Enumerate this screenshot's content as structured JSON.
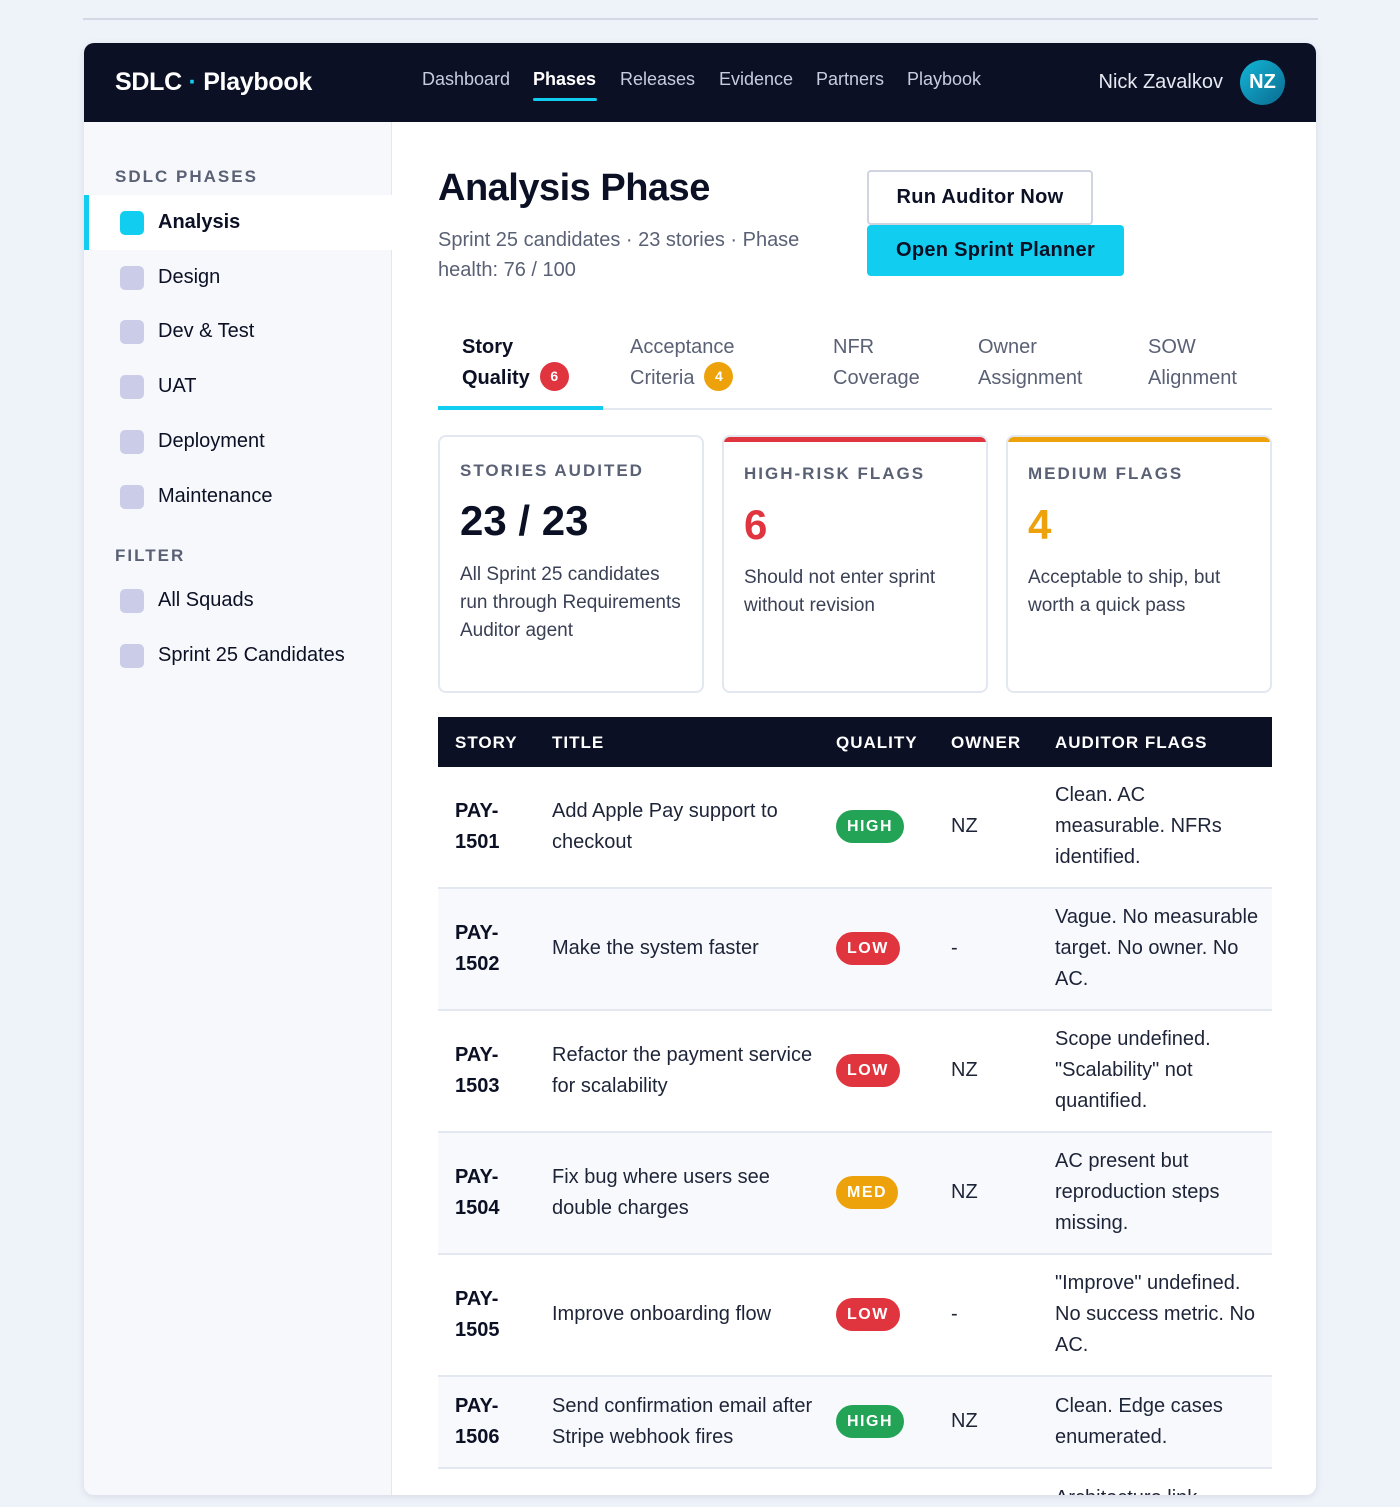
{
  "app": {
    "brand_left": "SDLC",
    "brand_dot": " · ",
    "brand_right": "Playbook"
  },
  "nav": {
    "items": [
      {
        "label": "Dashboard"
      },
      {
        "label": "Phases"
      },
      {
        "label": "Releases"
      },
      {
        "label": "Evidence"
      },
      {
        "label": "Partners"
      },
      {
        "label": "Playbook"
      }
    ],
    "active": "Phases"
  },
  "user": {
    "name": "Nick Zavalkov",
    "initials": "NZ"
  },
  "sidebar": {
    "phases_heading": "SDLC PHASES",
    "phases": [
      {
        "label": "Analysis"
      },
      {
        "label": "Design"
      },
      {
        "label": "Dev & Test"
      },
      {
        "label": "UAT"
      },
      {
        "label": "Deployment"
      },
      {
        "label": "Maintenance"
      }
    ],
    "filter_heading": "FILTER",
    "filters": [
      {
        "label": "All Squads"
      },
      {
        "label": "Sprint 25 Candidates"
      }
    ]
  },
  "page": {
    "title": "Analysis Phase",
    "subtitle": "Sprint 25 candidates · 23 stories · Phase health: 76 / 100",
    "run_auditor_label": "Run Auditor Now",
    "open_planner_label": "Open Sprint Planner"
  },
  "tabs": [
    {
      "line1": "Story",
      "line2": "Quality",
      "count": "6"
    },
    {
      "line1": "Acceptance",
      "line2": "Criteria",
      "count": "4"
    },
    {
      "line1": "NFR",
      "line2": "Coverage"
    },
    {
      "line1": "Owner",
      "line2": "Assignment"
    },
    {
      "line1": "SOW",
      "line2": "Alignment"
    }
  ],
  "cards": [
    {
      "label": "STORIES AUDITED",
      "value": "23 / 23",
      "desc": "All Sprint 25 candidates run through Requirements Auditor agent"
    },
    {
      "label": "HIGH-RISK FLAGS",
      "value": "6",
      "desc": "Should not enter sprint without revision",
      "accent": "#e0353f"
    },
    {
      "label": "MEDIUM FLAGS",
      "value": "4",
      "desc": "Acceptable to ship, but worth a quick pass",
      "accent": "#eda20b"
    }
  ],
  "table": {
    "headers": [
      "STORY",
      "TITLE",
      "QUALITY",
      "OWNER",
      "AUDITOR FLAGS"
    ],
    "rows": [
      {
        "story_a": "PAY-",
        "story_b": "1501",
        "title": "Add Apple Pay support to checkout",
        "quality": "HIGH",
        "owner": "NZ",
        "flags": "Clean. AC measurable. NFRs identified."
      },
      {
        "story_a": "PAY-",
        "story_b": "1502",
        "title": "Make the system faster",
        "quality": "LOW",
        "owner": "-",
        "flags": "Vague. No measurable target. No owner. No AC."
      },
      {
        "story_a": "PAY-",
        "story_b": "1503",
        "title": "Refactor the payment service for scalability",
        "quality": "LOW",
        "owner": "NZ",
        "flags": "Scope undefined. \"Scalability\" not quantified."
      },
      {
        "story_a": "PAY-",
        "story_b": "1504",
        "title": "Fix bug where users see double charges",
        "quality": "MED",
        "owner": "NZ",
        "flags": "AC present but reproduction steps missing."
      },
      {
        "story_a": "PAY-",
        "story_b": "1505",
        "title": "Improve onboarding flow",
        "quality": "LOW",
        "owner": "-",
        "flags": "\"Improve\" undefined. No success metric. No AC."
      },
      {
        "story_a": "PAY-",
        "story_b": "1506",
        "title": "Send confirmation email after Stripe webhook fires",
        "quality": "HIGH",
        "owner": "NZ",
        "flags": "Clean. Edge cases enumerated."
      },
      {
        "flags": "Architecture link"
      }
    ]
  },
  "colors": {
    "accent": "#11cdf0",
    "navy": "#0b1024",
    "high": "#22a355",
    "low": "#e0353f",
    "med": "#eda20b"
  }
}
